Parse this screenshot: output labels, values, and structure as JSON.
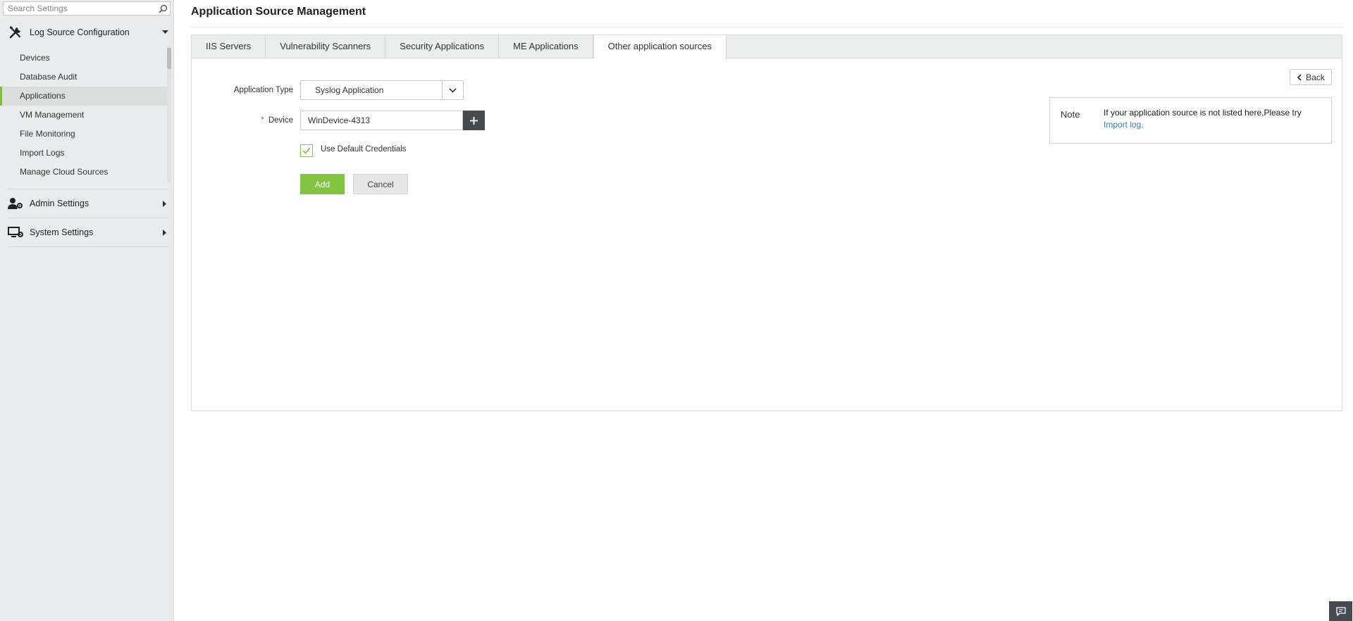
{
  "search": {
    "placeholder": "Search Settings"
  },
  "sidebar": {
    "sections": [
      {
        "label": "Log Source Configuration",
        "icon": "tools-icon",
        "expanded": true
      },
      {
        "label": "Admin Settings",
        "icon": "user-gear-icon",
        "expanded": false
      },
      {
        "label": "System Settings",
        "icon": "monitor-gear-icon",
        "expanded": false
      }
    ],
    "items": [
      {
        "label": "Devices"
      },
      {
        "label": "Database Audit"
      },
      {
        "label": "Applications",
        "active": true
      },
      {
        "label": "VM Management"
      },
      {
        "label": "File Monitoring"
      },
      {
        "label": "Import Logs"
      },
      {
        "label": "Manage Cloud Sources"
      }
    ]
  },
  "page": {
    "title": "Application Source Management"
  },
  "tabs": [
    {
      "label": "IIS Servers"
    },
    {
      "label": "Vulnerability Scanners"
    },
    {
      "label": "Security Applications"
    },
    {
      "label": "ME Applications"
    },
    {
      "label": "Other application sources",
      "active": true
    }
  ],
  "form": {
    "app_type_label": "Application Type",
    "app_type_value": "Syslog Application",
    "device_required_mark": "*",
    "device_label": "Device",
    "device_value": "WinDevice-4313",
    "use_default_label": "Use Default Credentials",
    "use_default_checked": true,
    "add_label": "Add",
    "cancel_label": "Cancel"
  },
  "back": {
    "label": "Back"
  },
  "note": {
    "title": "Note",
    "text": "If your application source is not listed here,Please try",
    "link": "Import log."
  },
  "colors": {
    "accent": "#82c341",
    "dark_button": "#434b51",
    "link": "#3a7bbf"
  }
}
